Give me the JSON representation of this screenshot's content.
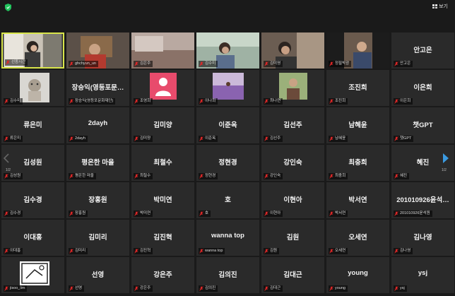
{
  "meeting": {
    "view_label": "보기",
    "page_left": "1/2",
    "page_right": "1/2",
    "icons": {
      "shield": "shield-icon",
      "view": "grid-view-icon",
      "muted": "mic-muted-icon",
      "next": "chevron-right-icon",
      "prev": "chevron-left-icon"
    },
    "colors": {
      "background": "#1a1a1a",
      "tile": "#2a2a2a",
      "active_border": "#d8e44a",
      "muted_icon": "#e02828",
      "shield": "#22c55e",
      "arrow": "#3b9ae0"
    }
  },
  "participants": [
    {
      "name": "",
      "label": "선종시간"
    },
    {
      "name": "",
      "label": "ghchyun_un"
    },
    {
      "name": "",
      "label": "김은주"
    },
    {
      "name": "",
      "label": "김수미"
    },
    {
      "name": "",
      "label": "김미영"
    },
    {
      "name": "",
      "label": "정필박광"
    },
    {
      "name": "안고은",
      "label": "안고은"
    },
    {
      "name": "",
      "label": "김수미"
    },
    {
      "name": "장승익(영등포문…",
      "label": "장승익(영등포문화재단)"
    },
    {
      "name": "",
      "label": "조영희"
    },
    {
      "name": "",
      "label": "이나희"
    },
    {
      "name": "",
      "label": "최나연"
    },
    {
      "name": "조진희",
      "label": "조진희"
    },
    {
      "name": "이은희",
      "label": "이은희"
    },
    {
      "name": "류은미",
      "label": "류은미"
    },
    {
      "name": "2dayh",
      "label": "2dayh"
    },
    {
      "name": "김미양",
      "label": "김미양"
    },
    {
      "name": "이준옥",
      "label": "이준옥"
    },
    {
      "name": "김선주",
      "label": "김선주"
    },
    {
      "name": "남혜윤",
      "label": "남혜윤"
    },
    {
      "name": "챗GPT",
      "label": "챗GPT"
    },
    {
      "name": "김성원",
      "label": "김성원"
    },
    {
      "name": "평온한 마을",
      "label": "평온한 마을"
    },
    {
      "name": "최철수",
      "label": "최철수"
    },
    {
      "name": "정현경",
      "label": "정현경"
    },
    {
      "name": "강인숙",
      "label": "강인숙"
    },
    {
      "name": "최충희",
      "label": "최충희"
    },
    {
      "name": "혜진",
      "label": "혜진"
    },
    {
      "name": "김수경",
      "label": "김수경"
    },
    {
      "name": "장홍원",
      "label": "장홍원"
    },
    {
      "name": "박미연",
      "label": "박미연"
    },
    {
      "name": "호",
      "label": "호"
    },
    {
      "name": "이현아",
      "label": "이현아"
    },
    {
      "name": "박서연",
      "label": "박서연"
    },
    {
      "name": "201010926윤석…",
      "label": "201010926윤석원"
    },
    {
      "name": "이대홍",
      "label": "이대홍"
    },
    {
      "name": "김미리",
      "label": "김미리"
    },
    {
      "name": "김진혁",
      "label": "김진혁"
    },
    {
      "name": "wanna top",
      "label": "wanna top"
    },
    {
      "name": "김원",
      "label": "김원"
    },
    {
      "name": "오세연",
      "label": "오세연"
    },
    {
      "name": "김나영",
      "label": "김나영"
    },
    {
      "name": "",
      "label": "jisoo_lim"
    },
    {
      "name": "선영",
      "label": "선영"
    },
    {
      "name": "강은주",
      "label": "강은주"
    },
    {
      "name": "김의진",
      "label": "김의진"
    },
    {
      "name": "김대근",
      "label": "김대근"
    },
    {
      "name": "young",
      "label": "young"
    },
    {
      "name": "ysj",
      "label": "ysj"
    }
  ]
}
